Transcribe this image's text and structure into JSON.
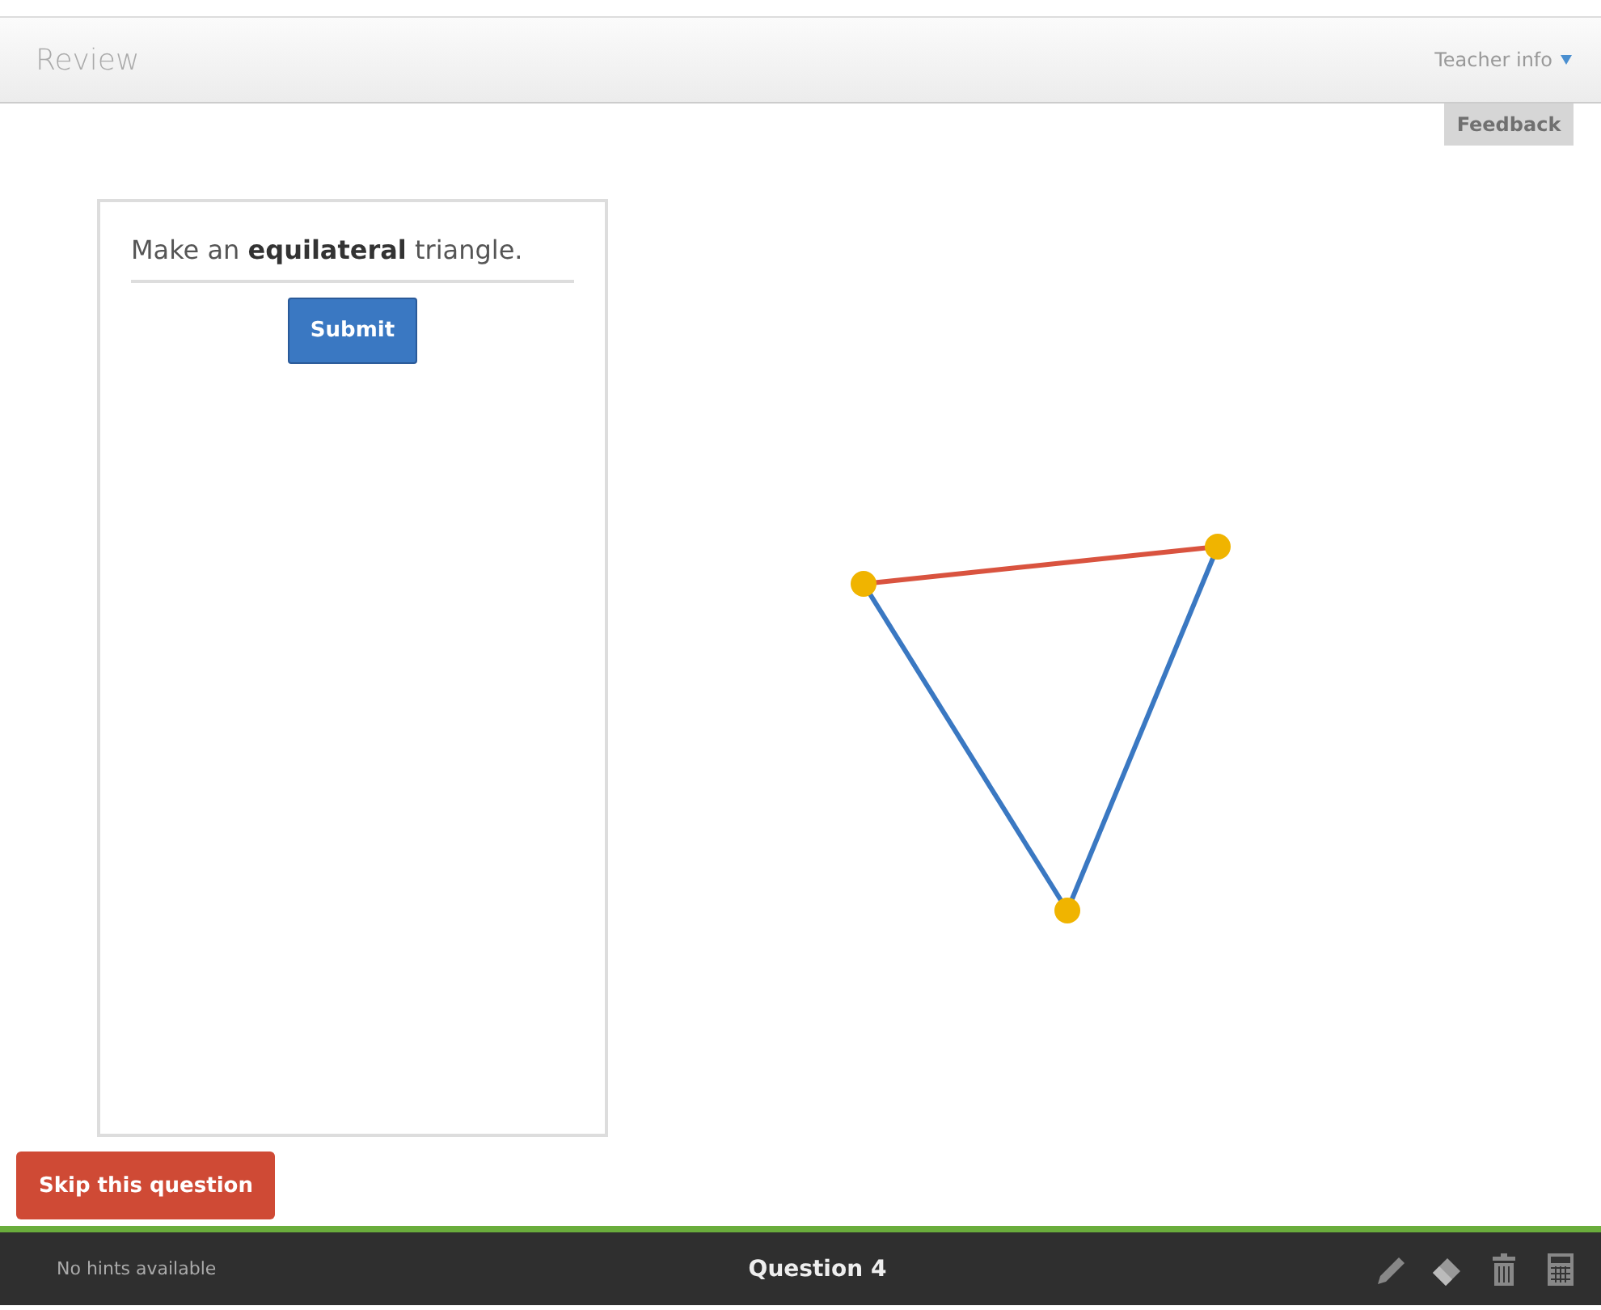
{
  "header": {
    "title": "Review",
    "menu": "Teacher info"
  },
  "feedback_button": {
    "label": "Feedback",
    "disabled": true
  },
  "question": {
    "prompt": "Make an **equilateral** triangle.",
    "submit": "Submit"
  },
  "triangle": {
    "segments": [
      {
        "color": "#d9533f"
      },
      {
        "color": "#3a78c2"
      },
      {
        "color": "#3a78c2"
      }
    ]
  },
  "skip_button": "Skip this question",
  "footer": {
    "hints": "No hints available",
    "question": "Question 4"
  }
}
